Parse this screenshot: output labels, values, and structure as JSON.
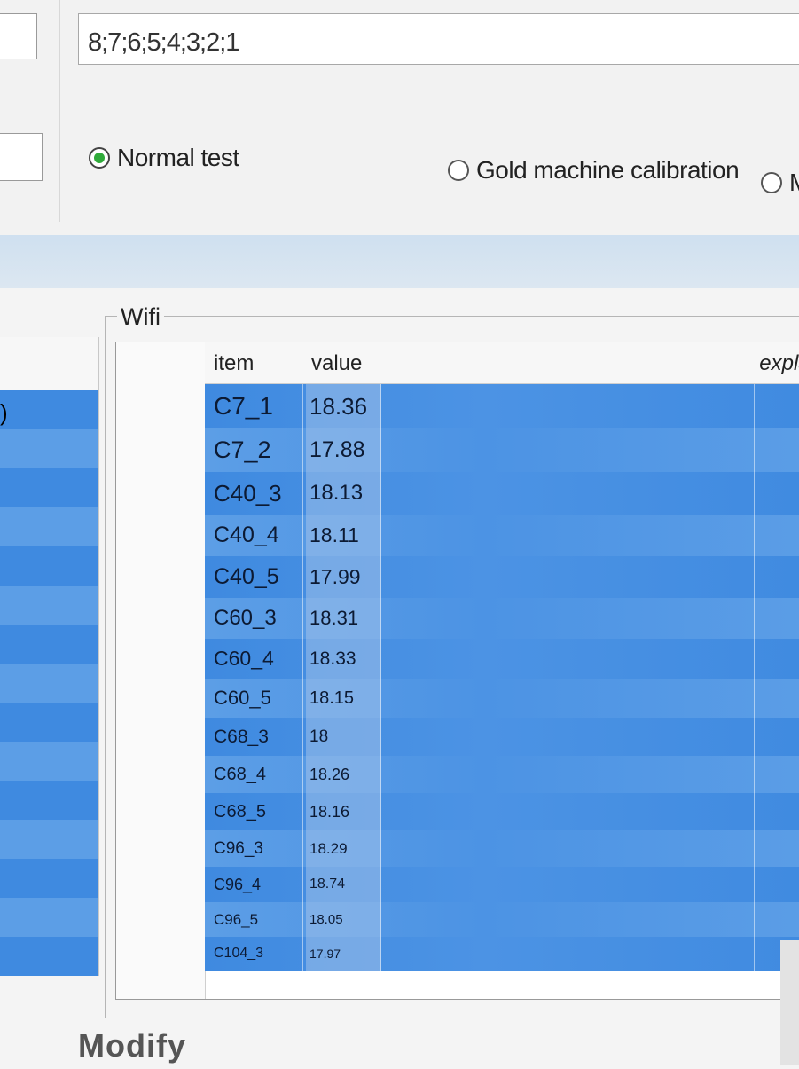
{
  "config": {
    "sequence_value": "8;7;6;5;4;3;2;1"
  },
  "test_mode": {
    "options": [
      {
        "label": "Normal test",
        "selected": true
      },
      {
        "label": "Gold machine calibration",
        "selected": false
      },
      {
        "label": "M",
        "selected": false
      }
    ]
  },
  "left_panel": {
    "partial_text": ")"
  },
  "wifi": {
    "group_title": "Wifi",
    "columns": {
      "item": "item",
      "value": "value",
      "explanation": "explan"
    },
    "rows": [
      {
        "item": "C7_1",
        "value": "18.36"
      },
      {
        "item": "C7_2",
        "value": "17.88"
      },
      {
        "item": "C40_3",
        "value": "18.13"
      },
      {
        "item": "C40_4",
        "value": "18.11"
      },
      {
        "item": "C40_5",
        "value": "17.99"
      },
      {
        "item": "C60_3",
        "value": "18.31"
      },
      {
        "item": "C60_4",
        "value": "18.33"
      },
      {
        "item": "C60_5",
        "value": "18.15"
      },
      {
        "item": "C68_3",
        "value": "18"
      },
      {
        "item": "C68_4",
        "value": "18.26"
      },
      {
        "item": "C68_5",
        "value": "18.16"
      },
      {
        "item": "C96_3",
        "value": "18.29"
      },
      {
        "item": "C96_4",
        "value": "18.74"
      },
      {
        "item": "C96_5",
        "value": "18.05"
      },
      {
        "item": "C104_3",
        "value": "17.97"
      }
    ]
  },
  "actions": {
    "modify_label": "Modify"
  },
  "colors": {
    "selection_blue_1": "#3f8ae0",
    "selection_blue_2": "#5c9ee6",
    "radio_selected": "#2faa3a"
  }
}
